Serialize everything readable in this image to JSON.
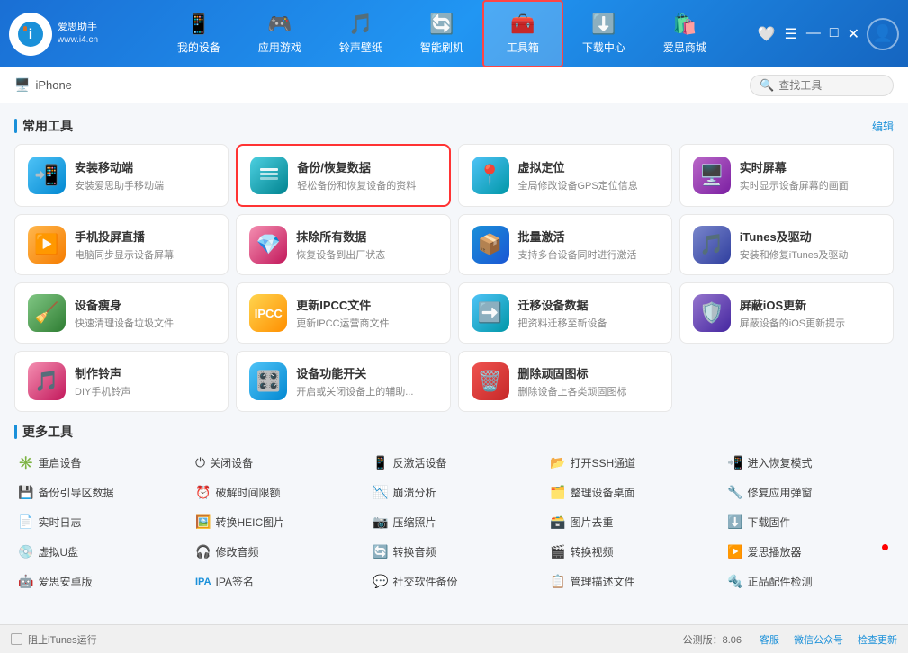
{
  "header": {
    "logo_name": "爱思助手",
    "logo_site": "www.i4.cn",
    "nav": [
      {
        "id": "my-device",
        "label": "我的设备",
        "icon": "📱"
      },
      {
        "id": "app-games",
        "label": "应用游戏",
        "icon": "🎮"
      },
      {
        "id": "ringtone",
        "label": "铃声壁纸",
        "icon": "🎵"
      },
      {
        "id": "smart-flash",
        "label": "智能刷机",
        "icon": "🔄"
      },
      {
        "id": "toolbox",
        "label": "工具箱",
        "icon": "🧰",
        "active": true
      },
      {
        "id": "download",
        "label": "下载中心",
        "icon": "⬇️"
      },
      {
        "id": "store",
        "label": "爱思商城",
        "icon": "🛍️"
      }
    ]
  },
  "subheader": {
    "device_name": "iPhone",
    "search_placeholder": "查找工具"
  },
  "common_tools": {
    "section_title": "常用工具",
    "edit_label": "编辑",
    "items": [
      {
        "id": "install-mobile",
        "name": "安装移动端",
        "desc": "安装爱思助手移动端",
        "icon": "📲",
        "bg": "bg-blue",
        "highlighted": false
      },
      {
        "id": "backup-restore",
        "name": "备份/恢复数据",
        "desc": "轻松备份和恢复设备的资料",
        "icon": "💾",
        "bg": "bg-teal",
        "highlighted": true
      },
      {
        "id": "virtual-location",
        "name": "虚拟定位",
        "desc": "全局修改设备GPS定位信息",
        "icon": "📍",
        "bg": "bg-cyan",
        "highlighted": false
      },
      {
        "id": "realtime-screen",
        "name": "实时屏幕",
        "desc": "实时显示设备屏幕的画面",
        "icon": "🖥️",
        "bg": "bg-purple",
        "highlighted": false
      },
      {
        "id": "phone-cast",
        "name": "手机投屏直播",
        "desc": "电脑同步显示设备屏幕",
        "icon": "▶️",
        "bg": "bg-orange",
        "highlighted": false
      },
      {
        "id": "erase-all",
        "name": "抹除所有数据",
        "desc": "恢复设备到出厂状态",
        "icon": "💎",
        "bg": "bg-pink",
        "highlighted": false
      },
      {
        "id": "batch-activate",
        "name": "批量激活",
        "desc": "支持多台设备同时进行激活",
        "icon": "📦",
        "bg": "bg-deepblue",
        "highlighted": false
      },
      {
        "id": "itunes-driver",
        "name": "iTunes及驱动",
        "desc": "安装和修复iTunes及驱动",
        "icon": "🎵",
        "bg": "bg-indigo",
        "highlighted": false
      },
      {
        "id": "device-slim",
        "name": "设备瘦身",
        "desc": "快速清理设备垃圾文件",
        "icon": "🧹",
        "bg": "bg-lightgreen",
        "highlighted": false
      },
      {
        "id": "update-ipcc",
        "name": "更新IPCC文件",
        "desc": "更新IPCC运营商文件",
        "icon": "📋",
        "bg": "bg-amber",
        "highlighted": false
      },
      {
        "id": "migrate-data",
        "name": "迁移设备数据",
        "desc": "把资料迁移至新设备",
        "icon": "➡️",
        "bg": "bg-cyan",
        "highlighted": false
      },
      {
        "id": "block-ios",
        "name": "屏蔽iOS更新",
        "desc": "屏蔽设备的iOS更新提示",
        "icon": "🛡️",
        "bg": "bg-deeppurple",
        "highlighted": false
      },
      {
        "id": "make-ringtone",
        "name": "制作铃声",
        "desc": "DIY手机铃声",
        "icon": "🎵",
        "bg": "bg-pink",
        "highlighted": false
      },
      {
        "id": "device-func",
        "name": "设备功能开关",
        "desc": "开启或关闭设备上的辅助...",
        "icon": "🎛️",
        "bg": "bg-blue",
        "highlighted": false
      },
      {
        "id": "delete-icons",
        "name": "删除顽固图标",
        "desc": "删除设备上各类顽固图标",
        "icon": "🗑️",
        "bg": "bg-red",
        "highlighted": false
      }
    ]
  },
  "more_tools": {
    "section_title": "更多工具",
    "items": [
      {
        "id": "reboot-device",
        "label": "重启设备",
        "icon": "✳️"
      },
      {
        "id": "shutdown-device",
        "label": "关闭设备",
        "icon": "⏻"
      },
      {
        "id": "deactivate",
        "label": "反激活设备",
        "icon": "📱"
      },
      {
        "id": "open-ssh",
        "label": "打开SSH通道",
        "icon": "📂"
      },
      {
        "id": "enter-recovery",
        "label": "进入恢复模式",
        "icon": "📲"
      },
      {
        "id": "backup-guide",
        "label": "备份引导区数据",
        "icon": "💾"
      },
      {
        "id": "break-time",
        "label": "破解时间限额",
        "icon": "⏰"
      },
      {
        "id": "crash-analysis",
        "label": "崩溃分析",
        "icon": "📉"
      },
      {
        "id": "organize-desktop",
        "label": "整理设备桌面",
        "icon": "🗂️"
      },
      {
        "id": "fix-app-crash",
        "label": "修复应用弹窗",
        "icon": "🔧"
      },
      {
        "id": "realtime-log",
        "label": "实时日志",
        "icon": "📄"
      },
      {
        "id": "convert-heic",
        "label": "转换HEIC图片",
        "icon": "🖼️"
      },
      {
        "id": "compress-photo",
        "label": "压缩照片",
        "icon": "📷"
      },
      {
        "id": "remove-duplicate",
        "label": "图片去重",
        "icon": "🗃️"
      },
      {
        "id": "download-firmware",
        "label": "下载固件",
        "icon": "⬇️"
      },
      {
        "id": "virtual-udisk",
        "label": "虚拟U盘",
        "icon": "💿"
      },
      {
        "id": "edit-audio",
        "label": "修改音频",
        "icon": "🎧"
      },
      {
        "id": "convert-audio",
        "label": "转换音频",
        "icon": "🔄"
      },
      {
        "id": "convert-video",
        "label": "转换视频",
        "icon": "🎬"
      },
      {
        "id": "aisi-player",
        "label": "爱思播放器",
        "icon": "▶️",
        "has_dot": true
      },
      {
        "id": "aisi-android",
        "label": "爱思安卓版",
        "icon": "🤖"
      },
      {
        "id": "ipa-sign",
        "label": "IPA签名",
        "icon": "✍️",
        "is_ipa": true
      },
      {
        "id": "social-backup",
        "label": "社交软件备份",
        "icon": "💬"
      },
      {
        "id": "manage-profile",
        "label": "管理描述文件",
        "icon": "📋"
      },
      {
        "id": "genuine-parts",
        "label": "正品配件检测",
        "icon": "🔩"
      }
    ]
  },
  "footer": {
    "itunes_label": "阻止iTunes运行",
    "version_label": "公测版：8.06",
    "service_label": "客服",
    "wechat_label": "微信公众号",
    "update_label": "检查更新"
  }
}
